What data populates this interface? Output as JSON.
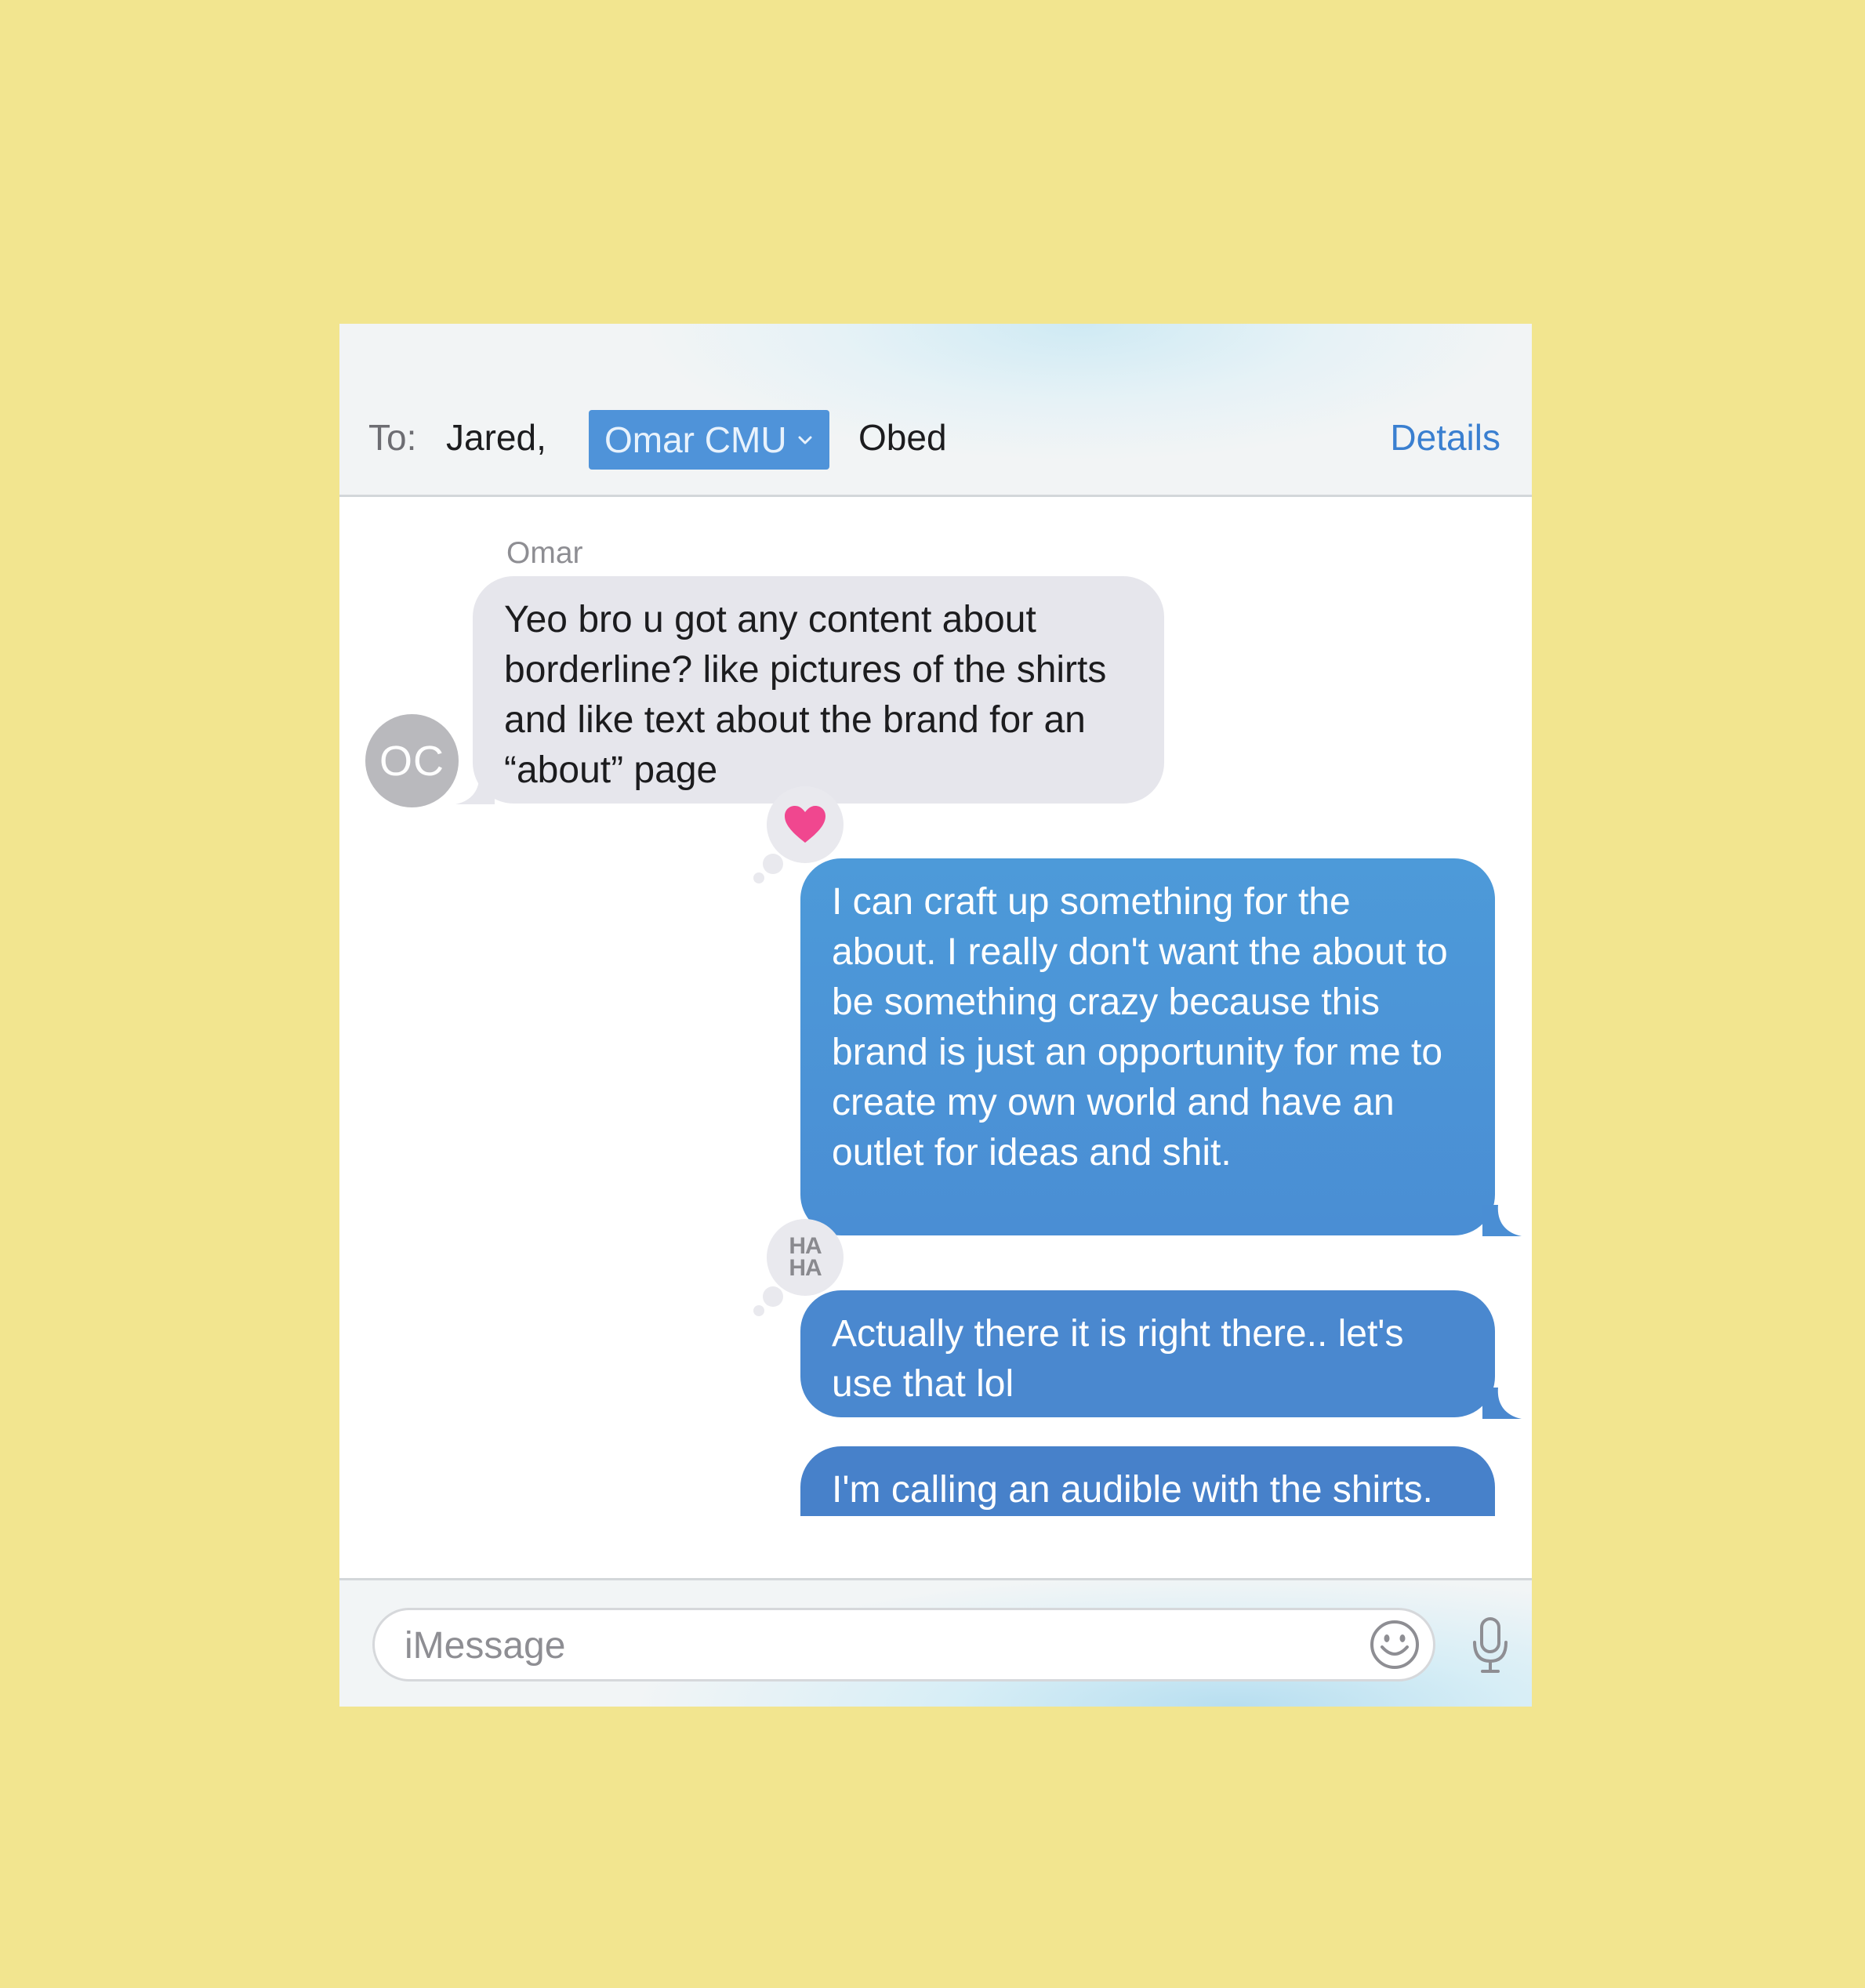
{
  "header": {
    "to_label": "To:",
    "recipients": [
      "Jared,",
      "Omar CMU",
      "Obed"
    ],
    "details_label": "Details"
  },
  "conversation": {
    "sender_name": "Omar",
    "avatar_initials": "OC",
    "messages": [
      {
        "direction": "incoming",
        "text": "Yeo bro u got any content about borderline? like pictures of the shirts and like text about the brand for an “about” page"
      },
      {
        "direction": "outgoing",
        "text": "I can craft up something for the about. I really don't want the about to be something crazy because this brand is just an opportunity for me to create my own world and have an outlet for ideas and shit.",
        "tapback": "heart-icon"
      },
      {
        "direction": "outgoing",
        "text": "Actually there it is right there.. let's use that lol",
        "tapback": "haha-icon"
      },
      {
        "direction": "outgoing",
        "text": "I'm calling an audible with the shirts. I'm going to get short"
      }
    ],
    "haha_text": "HA HA"
  },
  "composer": {
    "placeholder": "iMessage"
  },
  "colors": {
    "background": "#f2e58f",
    "outgoing_bubble": "#4a8ed4",
    "incoming_bubble": "#e6e6ec",
    "selected_recipient": "#4f93d9",
    "link": "#3a7fd0",
    "heart": "#f0478f"
  }
}
